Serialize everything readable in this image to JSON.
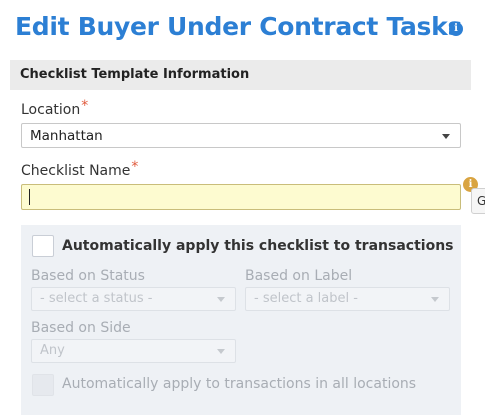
{
  "page": {
    "title": "Edit Buyer Under Contract Tasks",
    "title_info_icon": "info-circle-icon"
  },
  "section": {
    "title": "Checklist Template Information"
  },
  "location": {
    "label": "Location",
    "required_mark": "*",
    "value": "Manhattan"
  },
  "checklist_name": {
    "label": "Checklist Name",
    "required_mark": "*",
    "value": "",
    "warning_icon": "warning-icon",
    "side_button_label": "G"
  },
  "auto_apply": {
    "label": "Automatically apply this checklist to transactions",
    "checked": false,
    "status": {
      "label": "Based on Status",
      "placeholder": "- select a status -"
    },
    "label_filter": {
      "label": "Based on Label",
      "placeholder": "- select a label -"
    },
    "side": {
      "label": "Based on Side",
      "value": "Any"
    },
    "all_locations": {
      "label": "Automatically apply to transactions in all locations",
      "checked": false
    }
  },
  "colors": {
    "title": "#2c7fd4",
    "required": "#e05a3c",
    "input_highlight": "#fdfbd0",
    "panel": "#eef1f5"
  }
}
